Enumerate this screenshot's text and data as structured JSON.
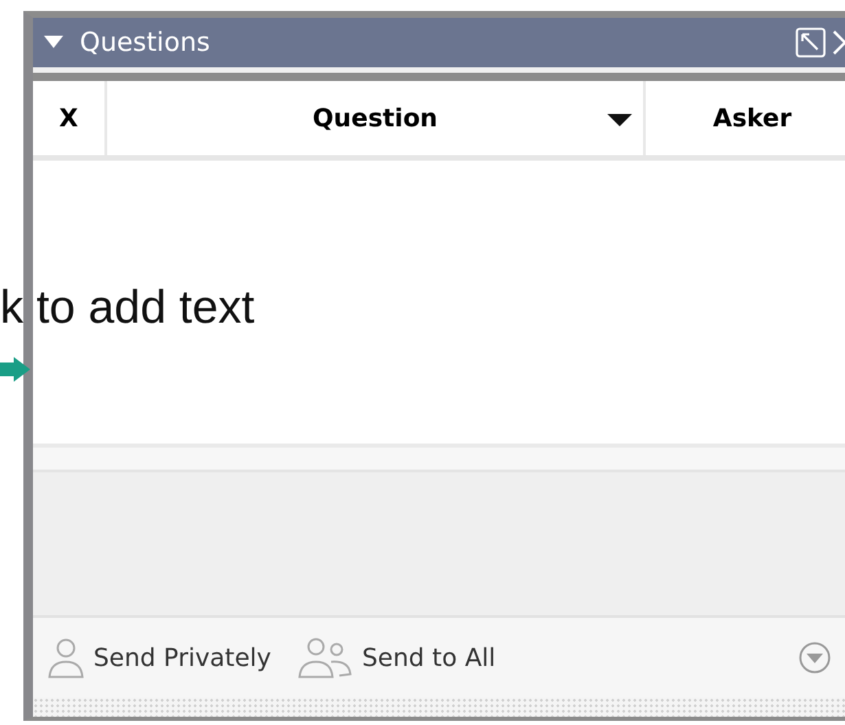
{
  "panel": {
    "title": "Questions"
  },
  "table": {
    "columns": [
      {
        "label": "X",
        "sorted": false
      },
      {
        "label": "Question",
        "sorted": true
      },
      {
        "label": "Asker",
        "sorted": false
      }
    ]
  },
  "overlay_text": "k to add text",
  "footer": {
    "buttons": [
      {
        "label": "Send Privately",
        "kind": "private"
      },
      {
        "label": "Send to All",
        "kind": "all"
      }
    ]
  }
}
